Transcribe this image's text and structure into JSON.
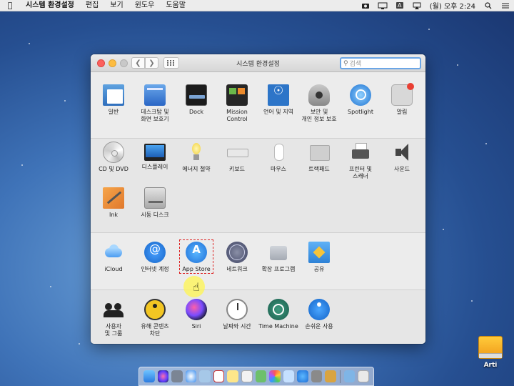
{
  "menubar": {
    "app_name": "시스템 환경설정",
    "menus": [
      "편집",
      "보기",
      "윈도우",
      "도움말"
    ],
    "clock": "(월) 오후 2:24",
    "input_source": "A"
  },
  "window": {
    "title": "시스템 환경설정",
    "search_placeholder": "검색"
  },
  "sections": {
    "personal": [
      {
        "label1": "일반",
        "label2": "",
        "icon": "general-icon"
      },
      {
        "label1": "데스크탑 및",
        "label2": "화면 보호기",
        "icon": "desktop-icon"
      },
      {
        "label1": "Dock",
        "label2": "",
        "icon": "dock-icon"
      },
      {
        "label1": "Mission",
        "label2": "Control",
        "icon": "mission-control-icon"
      },
      {
        "label1": "언어 및 지역",
        "label2": "",
        "icon": "language-region-icon"
      },
      {
        "label1": "보안 및",
        "label2": "개인 정보 보호",
        "icon": "security-icon"
      },
      {
        "label1": "Spotlight",
        "label2": "",
        "icon": "spotlight-icon"
      },
      {
        "label1": "알림",
        "label2": "",
        "icon": "notifications-icon"
      }
    ],
    "hardware": [
      {
        "label1": "CD 및 DVD",
        "label2": "",
        "icon": "cd-dvd-icon"
      },
      {
        "label1": "디스플레이",
        "label2": "",
        "icon": "display-icon"
      },
      {
        "label1": "에너지 절약",
        "label2": "",
        "icon": "energy-saver-icon"
      },
      {
        "label1": "키보드",
        "label2": "",
        "icon": "keyboard-icon"
      },
      {
        "label1": "마우스",
        "label2": "",
        "icon": "mouse-icon"
      },
      {
        "label1": "트랙패드",
        "label2": "",
        "icon": "trackpad-icon"
      },
      {
        "label1": "프린터 및",
        "label2": "스캐너",
        "icon": "printer-icon"
      },
      {
        "label1": "사운드",
        "label2": "",
        "icon": "sound-icon"
      },
      {
        "label1": "Ink",
        "label2": "",
        "icon": "ink-icon"
      },
      {
        "label1": "시동 디스크",
        "label2": "",
        "icon": "startup-disk-icon"
      }
    ],
    "internet": [
      {
        "label1": "iCloud",
        "label2": "",
        "icon": "icloud-icon"
      },
      {
        "label1": "인터넷 계정",
        "label2": "",
        "icon": "internet-accounts-icon"
      },
      {
        "label1": "App Store",
        "label2": "",
        "icon": "app-store-icon"
      },
      {
        "label1": "네트워크",
        "label2": "",
        "icon": "network-icon"
      },
      {
        "label1": "확장 프로그램",
        "label2": "",
        "icon": "extensions-icon"
      },
      {
        "label1": "공유",
        "label2": "",
        "icon": "sharing-icon"
      }
    ],
    "system": [
      {
        "label1": "사용자",
        "label2": "및 그룹",
        "icon": "users-groups-icon"
      },
      {
        "label1": "유해 콘텐츠",
        "label2": "차단",
        "icon": "parental-controls-icon"
      },
      {
        "label1": "Siri",
        "label2": "",
        "icon": "siri-icon"
      },
      {
        "label1": "날짜와 시간",
        "label2": "",
        "icon": "date-time-icon"
      },
      {
        "label1": "Time Machine",
        "label2": "",
        "icon": "time-machine-icon"
      },
      {
        "label1": "손쉬운 사용",
        "label2": "",
        "icon": "accessibility-icon"
      }
    ]
  },
  "desktop": {
    "drive_label": "Arti"
  },
  "colors": {
    "close": "#fc615d",
    "minimize": "#fdbc40",
    "highlight_box": "#dd2222",
    "cursor_ring": "#fff550"
  }
}
